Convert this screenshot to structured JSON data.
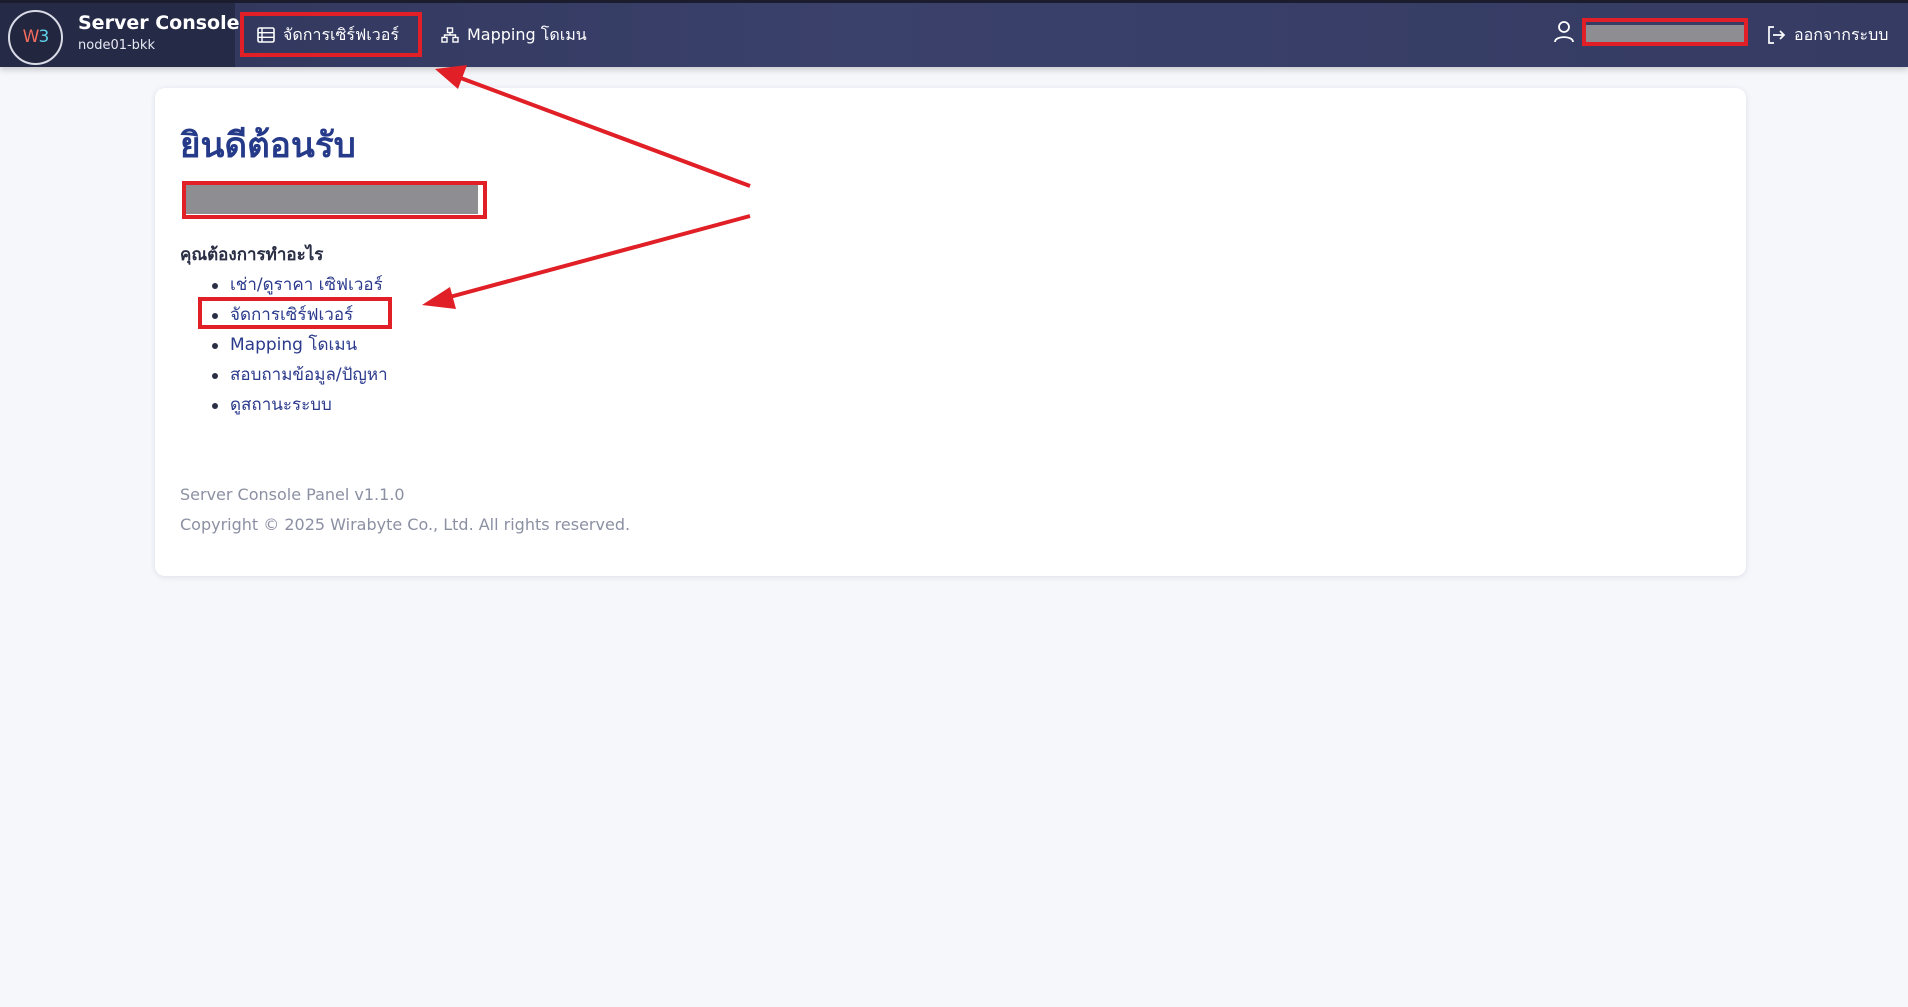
{
  "navbar": {
    "logo_text_w": "W",
    "logo_text_b": "3",
    "brand_title": "Server Console",
    "brand_subtitle": "node01-bkk",
    "menu": [
      {
        "label": "จัดการเซิร์ฟเวอร์",
        "icon": "server-list-icon"
      },
      {
        "label": "Mapping โดเมน",
        "icon": "sitemap-icon"
      }
    ],
    "user_icon": "user-icon",
    "user_name": "",
    "logout_label": "ออกจากระบบ",
    "logout_icon": "logout-icon"
  },
  "main": {
    "welcome_title": "ยินดีต้อนรับ",
    "user_display_name": "",
    "question": "คุณต้องการทำอะไร",
    "actions": [
      {
        "label": "เช่า/ดูราคา เซิฟเวอร์"
      },
      {
        "label": "จัดการเซิร์ฟเวอร์"
      },
      {
        "label": "Mapping โดเมน"
      },
      {
        "label": "สอบถามข้อมูล/ปัญหา"
      },
      {
        "label": "ดูสถานะระบบ"
      }
    ],
    "footer_version": "Server Console Panel v1.1.0",
    "footer_copyright": "Copyright © 2025 Wirabyte Co., Ltd. All rights reserved."
  },
  "colors": {
    "navbar_bg": "#353b62",
    "brand_bg": "#252a47",
    "heading": "#263a8a",
    "link": "#2b3a8c",
    "annotation": "#e01f26",
    "page_bg": "#f5f7fb"
  }
}
